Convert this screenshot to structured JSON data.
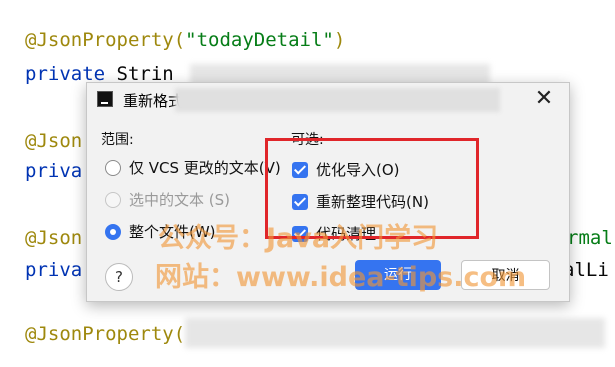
{
  "code": {
    "line1_anno": "@JsonProperty(",
    "line1_str": "\"todayDetail\"",
    "line1_close": ")",
    "line2_kw": "private",
    "line2_rest": " Strin",
    "line3": "@Json",
    "line4": "priva",
    "line5": "@Json",
    "line5_tail": "rmal",
    "line6": "priva",
    "line6_tail": "alLi",
    "line7": "@JsonProperty("
  },
  "dialog": {
    "title": "重新格式",
    "close_glyph": "✕",
    "scope_label": "范围:",
    "scope_options": [
      "仅 VCS 更改的文本(V)",
      "选中的文本 (S)",
      "整个文件(W)"
    ],
    "optional_label": "可选:",
    "optional_options": [
      "优化导入(O)",
      "重新整理代码(N)",
      "代码清理"
    ],
    "help": "?",
    "ok_button": "运行",
    "cancel_button": "取消"
  },
  "watermark": {
    "line1": "公众号：Java入门学习",
    "line2": "网站：www.idea-tips.com"
  },
  "colors": {
    "accent": "#3574f0",
    "highlight": "#e0262a"
  }
}
